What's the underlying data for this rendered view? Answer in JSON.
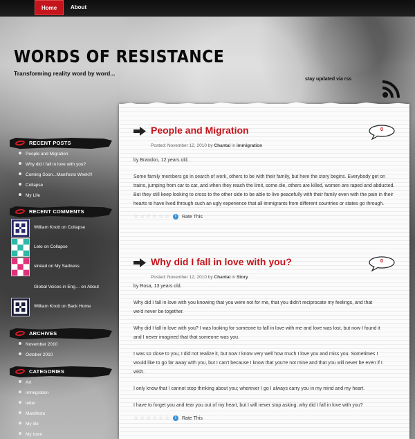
{
  "nav": {
    "home": "Home",
    "about": "About"
  },
  "site": {
    "title": "WORDS OF RESISTANCE",
    "tagline": "Transforming reality word by word...",
    "rss": "stay updated via rss"
  },
  "sidebar": {
    "recent_posts": {
      "title": "RECENT POSTS",
      "items": [
        "People and Migration",
        "Why did I fall in love with you?",
        "Coming Soon...Manifesto Week!!!",
        "Collapse",
        "My Life"
      ]
    },
    "recent_comments": {
      "title": "RECENT COMMENTS",
      "items": [
        "William Knott on Collapse",
        "Leto on Collapse",
        "sinéad on My Sadness",
        "Global Voices in Eng… on About",
        "William Knott on Back Home"
      ]
    },
    "archives": {
      "title": "ARCHIVES",
      "items": [
        "November 2010",
        "October 2010"
      ]
    },
    "categories": {
      "title": "CATEGORIES",
      "items": [
        "Art",
        "immigration",
        "letter",
        "Manifesto",
        "My life",
        "My town"
      ]
    }
  },
  "posts": [
    {
      "title": "People and Migration",
      "meta_posted": "Posted: November 12, 2010 by",
      "author": "Chantal",
      "meta_in": "in",
      "category": "immigration",
      "comments": "0",
      "paragraphs": [
        "by Brandon, 12 years old.",
        "Some family members go in search of work, others to be with their family, but here the story begins. Everybody get on trains, jumping from car to car, and when they reach the limit, some die, others are killed, women are raped and abducted. But they still keep looking to cross to the other side to be able to live peacefully with their family even with the pain in their hearts to have lived through such an ugly experience  that  all immigrants from different countries or states go through."
      ],
      "rate": "Rate This"
    },
    {
      "title": "Why did I fall in love with you?",
      "meta_posted": "Posted: November 12, 2010 by",
      "author": "Chantal",
      "meta_in": "in",
      "category": "Story",
      "comments": "0",
      "paragraphs": [
        "by Rosa, 13 years old.",
        "Why did I fall in love with you knowing that you were not for me, that you didn't reciprocate my feelings, and that we'd never be together.",
        "Why did I fall in love with you? I was looking for someone to fall in love with me and love was lost, but now I found it and I never imagined that that someone was you.",
        "I was so close to  you, I did not realize it, but now I know very well how much I love you and miss you. Sometimes I would like to go far away with you, but I can't because I know that  you're not mine and that you will never be even if I wish.",
        "I only  know that I cannot stop thinking about you; wherever I go I always carry you in my mind and my heart.",
        "I have to forget you and tear you out of my heart, but  I will never stop asking: why did I fall in love with you?"
      ],
      "rate": "Rate This"
    }
  ],
  "colors": {
    "accent": "#c4141c",
    "sidebar_head": "#141414"
  }
}
